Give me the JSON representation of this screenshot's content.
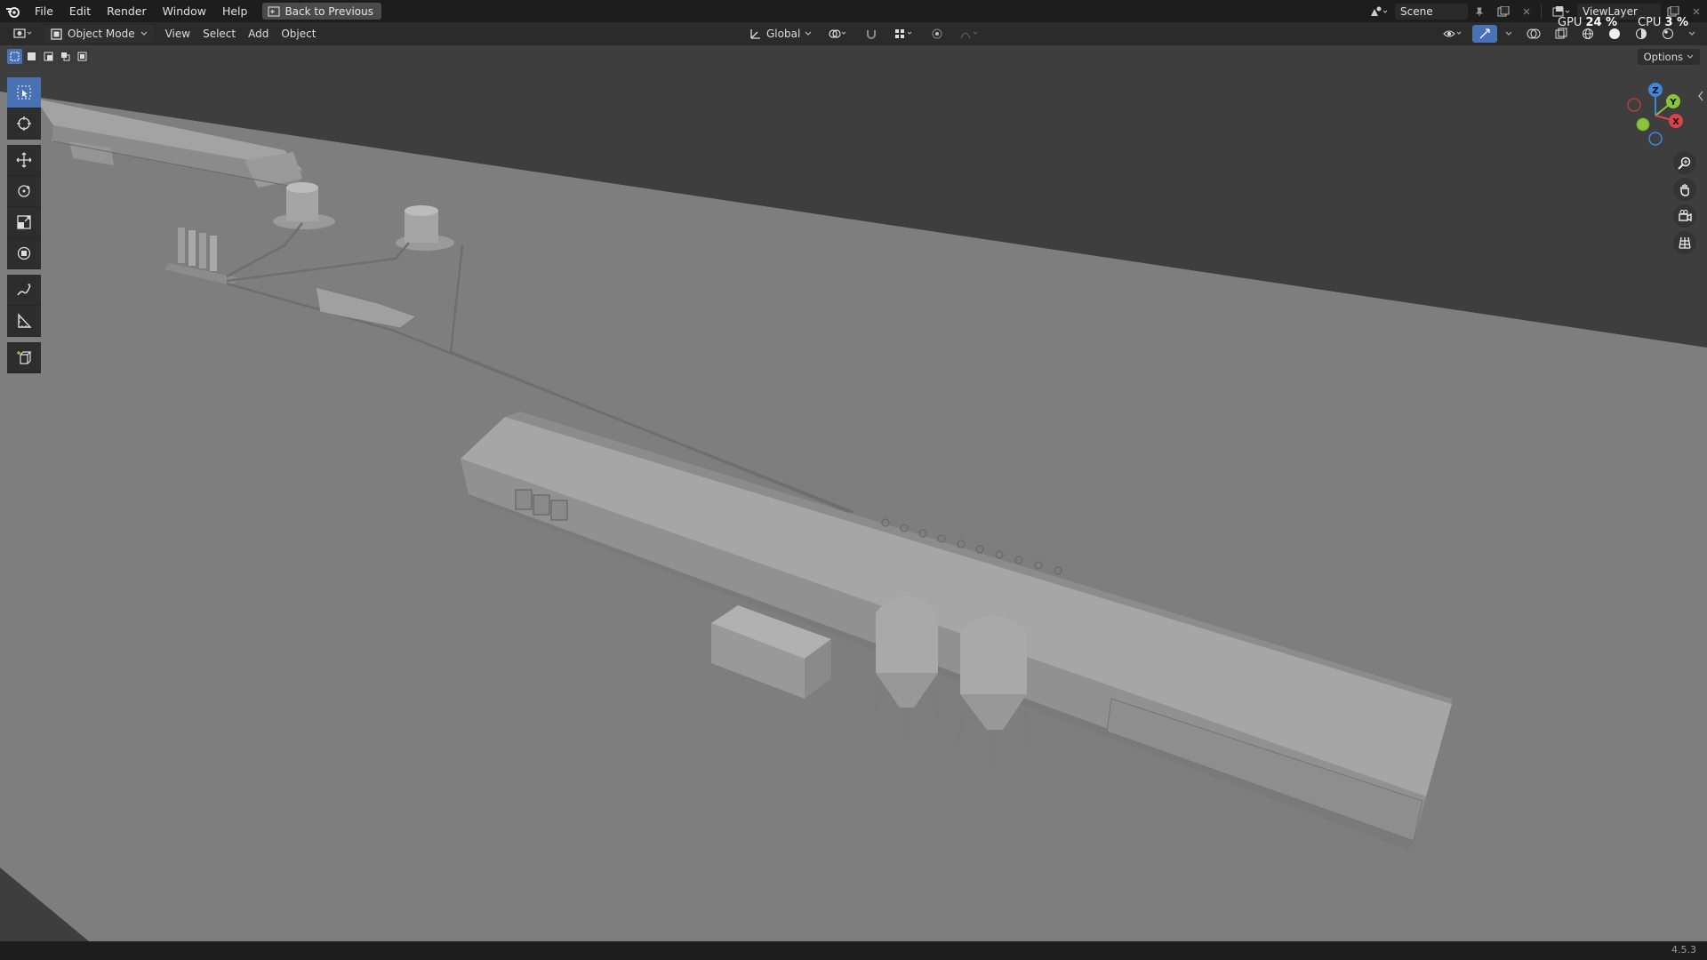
{
  "menu": {
    "items": [
      "File",
      "Edit",
      "Render",
      "Window",
      "Help"
    ],
    "back_button": "Back to Previous"
  },
  "top_right": {
    "scene": "Scene",
    "view_layer": "ViewLayer",
    "gpu_label": "GPU",
    "gpu_value": "24 %",
    "cpu_label": "CPU",
    "cpu_value": "3 %"
  },
  "header": {
    "mode": "Object Mode",
    "menus": [
      "View",
      "Select",
      "Add",
      "Object"
    ],
    "transform_orientation": "Global"
  },
  "viewport": {
    "options_label": "Options",
    "gizmo_axes": {
      "x": "X",
      "y": "Y",
      "z": "Z"
    }
  },
  "status": {
    "version": "4.5.3"
  },
  "colors": {
    "accent": "#4872b3",
    "x_axis": "#d9444c",
    "y_axis": "#8ac33c",
    "z_axis": "#3f87d8"
  },
  "icons": [
    "blender-logo-icon",
    "select-box-icon",
    "cursor-icon",
    "move-icon",
    "rotate-icon",
    "scale-icon",
    "transform-icon",
    "annotate-icon",
    "measure-icon",
    "add-cube-icon",
    "zoom-icon",
    "hand-pan-icon",
    "camera-icon",
    "grid-icon"
  ]
}
